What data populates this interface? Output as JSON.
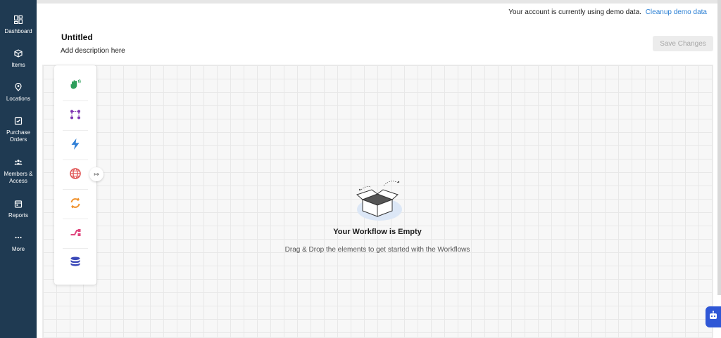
{
  "sidebar": {
    "items": [
      {
        "label": "Dashboard",
        "icon": "dashboard-icon"
      },
      {
        "label": "Items",
        "icon": "box-icon"
      },
      {
        "label": "Locations",
        "icon": "location-pin-icon"
      },
      {
        "label": "Purchase\nOrders",
        "icon": "clipboard-check-icon"
      },
      {
        "label": "Members &\nAccess",
        "icon": "users-icon"
      },
      {
        "label": "Reports",
        "icon": "calendar-icon"
      },
      {
        "label": "More",
        "icon": "more-dots-icon"
      }
    ]
  },
  "demo_notice": {
    "text": "Your account is currently using demo data.",
    "link": "Cleanup demo data"
  },
  "workflow": {
    "title": "Untitled",
    "description": "Add description here",
    "save_label": "Save Changes"
  },
  "toolbox": {
    "tools": [
      {
        "icon": "hand-wave-icon",
        "color": "#2e9e5b"
      },
      {
        "icon": "branch-nodes-icon",
        "color": "#7b2fb0"
      },
      {
        "icon": "lightning-icon",
        "color": "#2f7fd6"
      },
      {
        "icon": "globe-icon",
        "color": "#e05454"
      },
      {
        "icon": "refresh-icon",
        "color": "#f0912b"
      },
      {
        "icon": "split-arrow-icon",
        "color": "#e0467e"
      },
      {
        "icon": "database-icon",
        "color": "#3a48b8"
      }
    ],
    "expand_icon": "expand-arrow-icon"
  },
  "empty_state": {
    "title": "Your Workflow is Empty",
    "subtitle": "Drag & Drop the elements to get started with the Workflows"
  },
  "colors": {
    "sidebar_bg": "#1f3a52",
    "link": "#2a7fd4",
    "assistant": "#2f57d6"
  }
}
